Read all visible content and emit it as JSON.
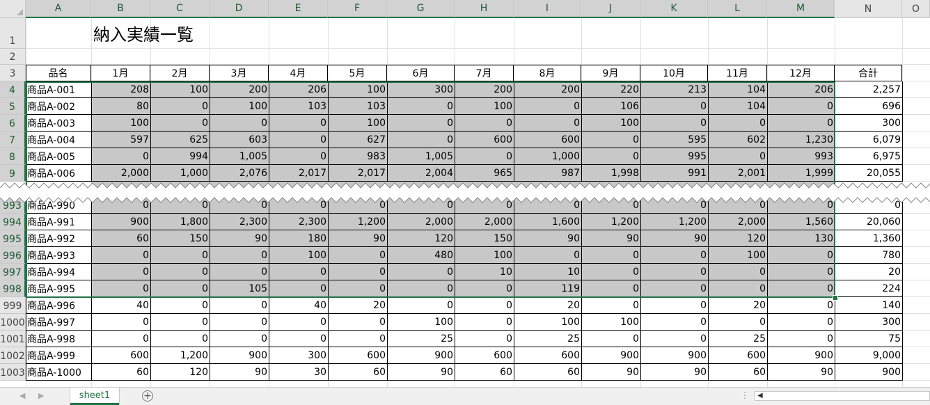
{
  "columns": [
    "A",
    "B",
    "C",
    "D",
    "E",
    "F",
    "G",
    "H",
    "I",
    "J",
    "K",
    "L",
    "M",
    "N",
    "O"
  ],
  "title": "納入実績一覧",
  "table_header": [
    "品名",
    "1月",
    "2月",
    "3月",
    "4月",
    "5月",
    "6月",
    "7月",
    "8月",
    "9月",
    "10月",
    "11月",
    "12月",
    "合計"
  ],
  "rows_top": [
    {
      "num": "1"
    },
    {
      "num": "2"
    },
    {
      "num": "3"
    },
    {
      "num": "4",
      "name": "商品A-001",
      "values": [
        "208",
        "100",
        "200",
        "206",
        "100",
        "300",
        "200",
        "200",
        "220",
        "213",
        "104",
        "206"
      ],
      "total": "2,257"
    },
    {
      "num": "5",
      "name": "商品A-002",
      "values": [
        "80",
        "0",
        "100",
        "103",
        "103",
        "0",
        "100",
        "0",
        "106",
        "0",
        "104",
        "0"
      ],
      "total": "696"
    },
    {
      "num": "6",
      "name": "商品A-003",
      "values": [
        "100",
        "0",
        "0",
        "0",
        "100",
        "0",
        "0",
        "0",
        "100",
        "0",
        "0",
        "0"
      ],
      "total": "300"
    },
    {
      "num": "7",
      "name": "商品A-004",
      "values": [
        "597",
        "625",
        "603",
        "0",
        "627",
        "0",
        "600",
        "600",
        "0",
        "595",
        "602",
        "1,230"
      ],
      "total": "6,079"
    },
    {
      "num": "8",
      "name": "商品A-005",
      "values": [
        "0",
        "994",
        "1,005",
        "0",
        "983",
        "1,005",
        "0",
        "1,000",
        "0",
        "995",
        "0",
        "993"
      ],
      "total": "6,975"
    },
    {
      "num": "9",
      "name": "商品A-006",
      "values": [
        "2,000",
        "1,000",
        "2,076",
        "2,017",
        "2,017",
        "2,004",
        "965",
        "987",
        "1,998",
        "991",
        "2,001",
        "1,999"
      ],
      "total": "20,055"
    }
  ],
  "rows_bottom": [
    {
      "num": "993",
      "name": "商品A-990",
      "values": [
        "0",
        "0",
        "0",
        "0",
        "0",
        "0",
        "0",
        "0",
        "0",
        "0",
        "0",
        "0"
      ],
      "total": "0"
    },
    {
      "num": "994",
      "name": "商品A-991",
      "values": [
        "900",
        "1,800",
        "2,300",
        "2,300",
        "1,200",
        "2,000",
        "2,000",
        "1,600",
        "1,200",
        "1,200",
        "2,000",
        "1,560"
      ],
      "total": "20,060"
    },
    {
      "num": "995",
      "name": "商品A-992",
      "values": [
        "60",
        "150",
        "90",
        "180",
        "90",
        "120",
        "150",
        "90",
        "90",
        "90",
        "120",
        "130"
      ],
      "total": "1,360"
    },
    {
      "num": "996",
      "name": "商品A-993",
      "values": [
        "0",
        "0",
        "0",
        "100",
        "0",
        "480",
        "100",
        "0",
        "0",
        "0",
        "100",
        "0"
      ],
      "total": "780"
    },
    {
      "num": "997",
      "name": "商品A-994",
      "values": [
        "0",
        "0",
        "0",
        "0",
        "0",
        "0",
        "10",
        "10",
        "0",
        "0",
        "0",
        "0"
      ],
      "total": "20"
    },
    {
      "num": "998",
      "name": "商品A-995",
      "values": [
        "0",
        "0",
        "105",
        "0",
        "0",
        "0",
        "0",
        "119",
        "0",
        "0",
        "0",
        "0"
      ],
      "total": "224"
    },
    {
      "num": "999",
      "name": "商品A-996",
      "values": [
        "40",
        "0",
        "0",
        "40",
        "20",
        "0",
        "0",
        "20",
        "0",
        "0",
        "20",
        "0"
      ],
      "total": "140"
    },
    {
      "num": "1000",
      "name": "商品A-997",
      "values": [
        "0",
        "0",
        "0",
        "0",
        "0",
        "100",
        "0",
        "100",
        "100",
        "0",
        "0",
        "0"
      ],
      "total": "300"
    },
    {
      "num": "1001",
      "name": "商品A-998",
      "values": [
        "0",
        "0",
        "0",
        "0",
        "0",
        "25",
        "0",
        "25",
        "0",
        "0",
        "25",
        "0"
      ],
      "total": "75"
    },
    {
      "num": "1002",
      "name": "商品A-999",
      "values": [
        "600",
        "1,200",
        "900",
        "300",
        "600",
        "900",
        "600",
        "600",
        "900",
        "900",
        "600",
        "900"
      ],
      "total": "9,000"
    },
    {
      "num": "1003",
      "name": "商品A-1000",
      "values": [
        "60",
        "120",
        "90",
        "30",
        "60",
        "90",
        "60",
        "60",
        "90",
        "90",
        "60",
        "90"
      ],
      "total": "900"
    }
  ],
  "sheet_tab": "sheet1",
  "add_sheet": "+",
  "colors": {
    "selection": "#217346",
    "selected_fill": "#c8c8c8",
    "header_bg": "#e6e6e6"
  }
}
